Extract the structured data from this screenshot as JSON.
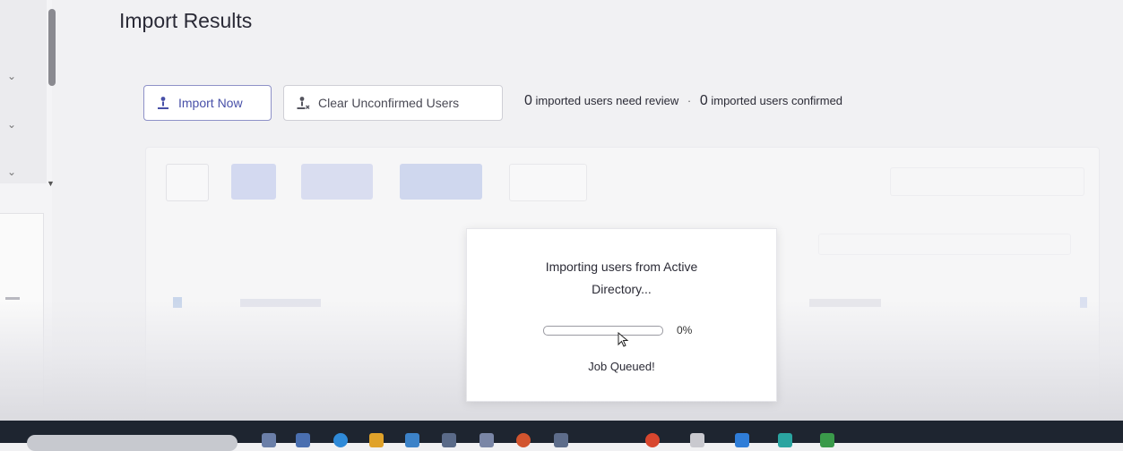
{
  "page": {
    "title": "Import Results"
  },
  "toolbar": {
    "import_label": "Import Now",
    "clear_label": "Clear Unconfirmed Users"
  },
  "stats": {
    "review_count": "0",
    "review_label": "imported users need review",
    "separator": "·",
    "confirmed_count": "0",
    "confirmed_label": "imported users confirmed"
  },
  "dialog": {
    "message_line1": "Importing users from Active",
    "message_line2": "Directory...",
    "progress_value": 0,
    "progress_text": "0%",
    "status": "Job Queued!"
  },
  "colors": {
    "accent": "#4850a8",
    "progress_fill": "#4a8fe0",
    "taskbar": "#1e2530"
  }
}
